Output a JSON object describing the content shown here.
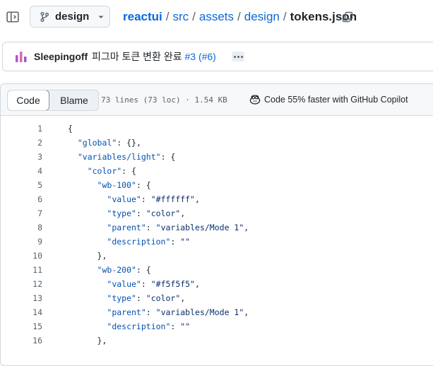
{
  "header": {
    "branch": "design",
    "breadcrumb": [
      {
        "label": "reactui",
        "link": true
      },
      {
        "label": "src",
        "link": true
      },
      {
        "label": "assets",
        "link": true
      },
      {
        "label": "design",
        "link": true
      },
      {
        "label": "tokens.json",
        "link": false
      }
    ],
    "separator": "/",
    "icons": {
      "sidebar": "sidebar-toggle-icon",
      "branch": "git-branch-icon",
      "caret": "caret-down-icon",
      "copy": "copy-icon"
    }
  },
  "commit": {
    "author": "Sleepingoff",
    "message": "피그마 토큰 변환 완료 ",
    "pr_refs": "#3 (#6)"
  },
  "file": {
    "view_tabs": {
      "code": "Code",
      "blame": "Blame"
    },
    "meta": "73 lines (73 loc) · 1.54 KB",
    "copilot_text": "Code 55% faster with GitHub Copilot"
  },
  "colors": {
    "link": "#0969da",
    "key": "#0550ae",
    "string": "#0a3069",
    "line_number": "#59636e"
  },
  "code_lines": [
    {
      "n": "1",
      "indent": "",
      "parts": [
        [
          "p",
          "{"
        ]
      ]
    },
    {
      "n": "2",
      "indent": "  ",
      "parts": [
        [
          "k",
          "\"global\""
        ],
        [
          "p",
          ": {},"
        ]
      ]
    },
    {
      "n": "3",
      "indent": "  ",
      "parts": [
        [
          "k",
          "\"variables/light\""
        ],
        [
          "p",
          ": {"
        ]
      ]
    },
    {
      "n": "4",
      "indent": "    ",
      "parts": [
        [
          "k",
          "\"color\""
        ],
        [
          "p",
          ": {"
        ]
      ]
    },
    {
      "n": "5",
      "indent": "      ",
      "parts": [
        [
          "k",
          "\"wb-100\""
        ],
        [
          "p",
          ": {"
        ]
      ]
    },
    {
      "n": "6",
      "indent": "        ",
      "parts": [
        [
          "k",
          "\"value\""
        ],
        [
          "p",
          ": "
        ],
        [
          "s",
          "\"#ffffff\""
        ],
        [
          "p",
          ","
        ]
      ]
    },
    {
      "n": "7",
      "indent": "        ",
      "parts": [
        [
          "k",
          "\"type\""
        ],
        [
          "p",
          ": "
        ],
        [
          "s",
          "\"color\""
        ],
        [
          "p",
          ","
        ]
      ]
    },
    {
      "n": "8",
      "indent": "        ",
      "parts": [
        [
          "k",
          "\"parent\""
        ],
        [
          "p",
          ": "
        ],
        [
          "s",
          "\"variables/Mode 1\""
        ],
        [
          "p",
          ","
        ]
      ]
    },
    {
      "n": "9",
      "indent": "        ",
      "parts": [
        [
          "k",
          "\"description\""
        ],
        [
          "p",
          ": "
        ],
        [
          "s",
          "\"\""
        ]
      ]
    },
    {
      "n": "10",
      "indent": "      ",
      "parts": [
        [
          "p",
          "},"
        ]
      ]
    },
    {
      "n": "11",
      "indent": "      ",
      "parts": [
        [
          "k",
          "\"wb-200\""
        ],
        [
          "p",
          ": {"
        ]
      ]
    },
    {
      "n": "12",
      "indent": "        ",
      "parts": [
        [
          "k",
          "\"value\""
        ],
        [
          "p",
          ": "
        ],
        [
          "s",
          "\"#f5f5f5\""
        ],
        [
          "p",
          ","
        ]
      ]
    },
    {
      "n": "13",
      "indent": "        ",
      "parts": [
        [
          "k",
          "\"type\""
        ],
        [
          "p",
          ": "
        ],
        [
          "s",
          "\"color\""
        ],
        [
          "p",
          ","
        ]
      ]
    },
    {
      "n": "14",
      "indent": "        ",
      "parts": [
        [
          "k",
          "\"parent\""
        ],
        [
          "p",
          ": "
        ],
        [
          "s",
          "\"variables/Mode 1\""
        ],
        [
          "p",
          ","
        ]
      ]
    },
    {
      "n": "15",
      "indent": "        ",
      "parts": [
        [
          "k",
          "\"description\""
        ],
        [
          "p",
          ": "
        ],
        [
          "s",
          "\"\""
        ]
      ]
    },
    {
      "n": "16",
      "indent": "      ",
      "parts": [
        [
          "p",
          "},"
        ]
      ]
    }
  ]
}
